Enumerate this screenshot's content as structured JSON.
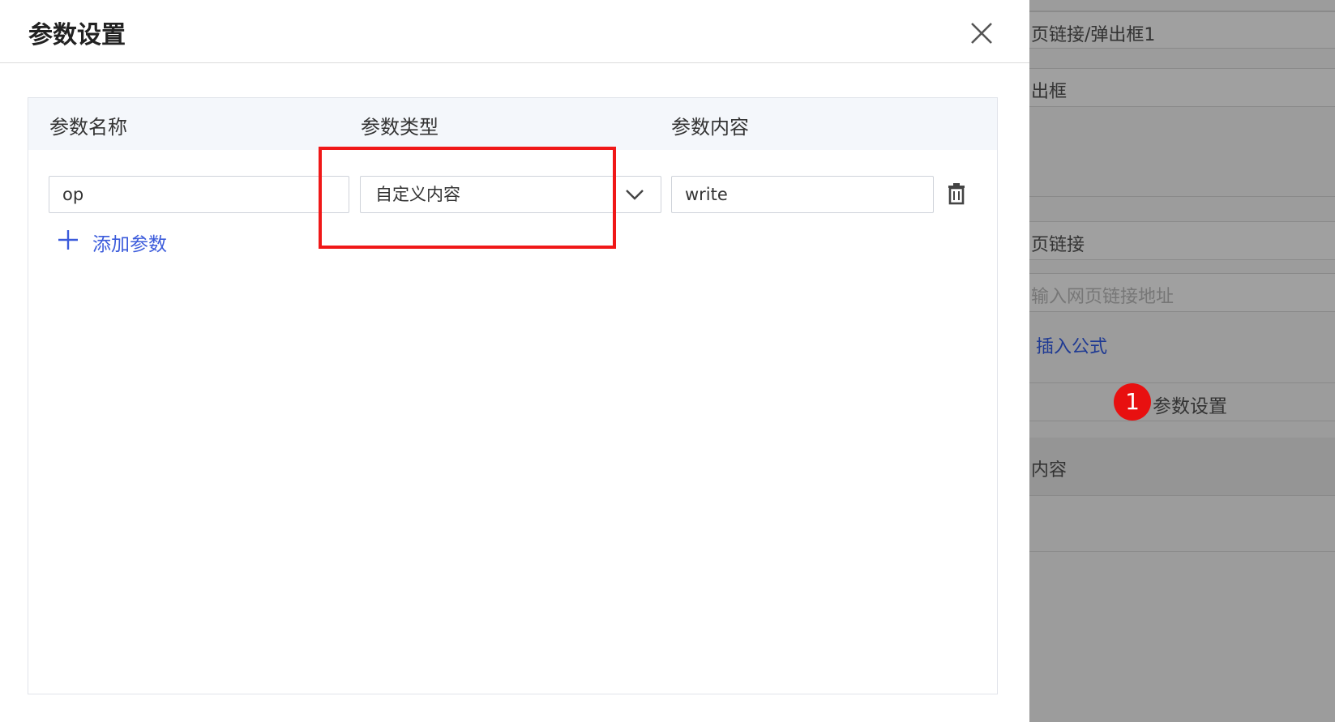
{
  "dialog": {
    "title": "参数设置",
    "columns": [
      "参数名称",
      "参数类型",
      "参数内容"
    ],
    "row": {
      "name_value": "op",
      "type_value": "自定义内容",
      "content_value": "write"
    },
    "add_param_label": "添加参数"
  },
  "background": {
    "item1": "页链接/弹出框1",
    "item2": "出框",
    "item3": "页链接",
    "url_placeholder": "输入网页链接地址",
    "insert_formula": "插入公式",
    "badge_number": "1",
    "param_settings": "参数设置",
    "item_content": "内容"
  },
  "colors": {
    "highlight": "#f01818",
    "link": "#3b5bdb",
    "badge": "#e81010"
  }
}
